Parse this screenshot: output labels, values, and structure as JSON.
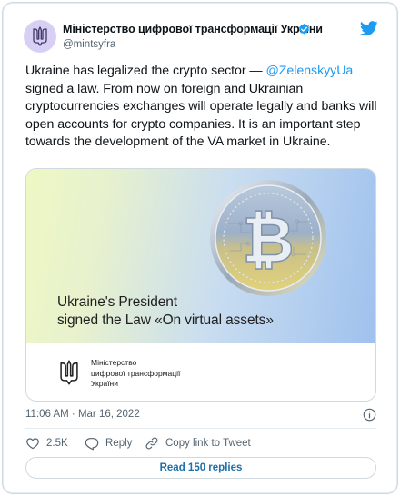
{
  "author": {
    "name": "Міністерство цифрової трансформації України",
    "handle": "@mintsyfra"
  },
  "tweet": {
    "text_before": "Ukraine has legalized the crypto sector — ",
    "mention": "@ZelenskyyUa",
    "text_after": " signed a law. From now on foreign and Ukrainian cryptocurrencies exchanges will operate legally and banks will open accounts for crypto companies. It is an important step towards the development of the VA market in Ukraine."
  },
  "media": {
    "headline_line1": "Ukraine's President",
    "headline_line2": "signed the Law «On virtual assets»",
    "org_line1": "Міністерство",
    "org_line2": "цифрової трансформації",
    "org_line3": "України"
  },
  "meta": {
    "timestamp": "11:06 AM · Mar 16, 2022"
  },
  "actions": {
    "likes": "2.5K",
    "reply_label": "Reply",
    "copy_label": "Copy link to Tweet",
    "read_replies": "Read 150 replies"
  },
  "colors": {
    "accent": "#1d9bf0",
    "verified": "#1d9bf0",
    "like_icon": "#536471"
  },
  "icons": [
    "ukraine-trident-icon",
    "verified-badge-icon",
    "twitter-bird-icon",
    "info-icon",
    "heart-icon",
    "reply-bubble-icon",
    "link-icon",
    "bitcoin-coin"
  ]
}
